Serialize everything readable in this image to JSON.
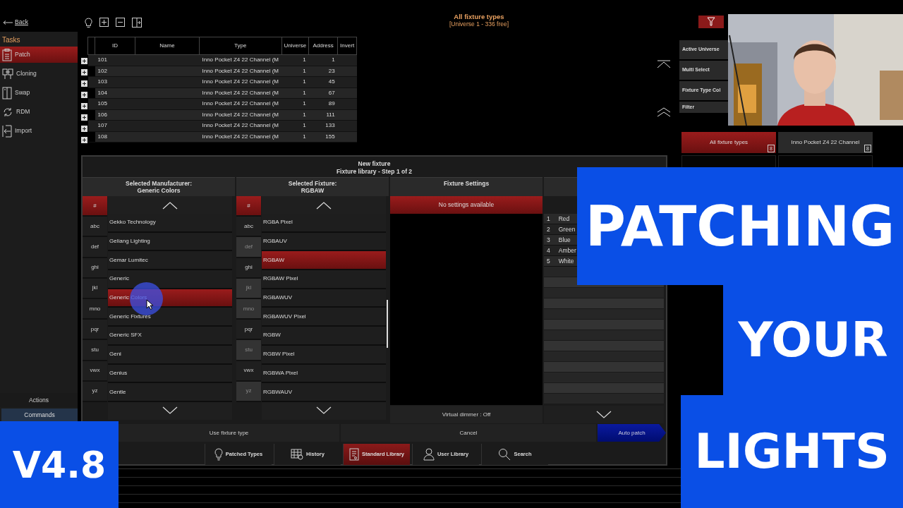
{
  "sidebar": {
    "back": "Back",
    "section": "Tasks",
    "items": [
      {
        "label": "Patch",
        "selected": true
      },
      {
        "label": "Cloning",
        "selected": false
      },
      {
        "label": "Swap",
        "selected": false
      },
      {
        "label": "RDM",
        "selected": false
      },
      {
        "label": "Import",
        "selected": false
      }
    ],
    "actions_label": "Actions",
    "commands": "Commands"
  },
  "header": {
    "title": "All fixture types",
    "subtitle": "[Universe 1 - 336 free]"
  },
  "table": {
    "columns": [
      "ID",
      "Name",
      "Type",
      "Universe",
      "Address",
      "Invert"
    ],
    "rows": [
      {
        "id": "101",
        "type": "Inno Pocket Z4 22 Channel (M",
        "universe": "1",
        "address": "1"
      },
      {
        "id": "102",
        "type": "Inno Pocket Z4 22 Channel (M",
        "universe": "1",
        "address": "23"
      },
      {
        "id": "103",
        "type": "Inno Pocket Z4 22 Channel (M",
        "universe": "1",
        "address": "45"
      },
      {
        "id": "104",
        "type": "Inno Pocket Z4 22 Channel (M",
        "universe": "1",
        "address": "67"
      },
      {
        "id": "105",
        "type": "Inno Pocket Z4 22 Channel (M",
        "universe": "1",
        "address": "89"
      },
      {
        "id": "106",
        "type": "Inno Pocket Z4 22 Channel (M",
        "universe": "1",
        "address": "111"
      },
      {
        "id": "107",
        "type": "Inno Pocket Z4 22 Channel (M",
        "universe": "1",
        "address": "133"
      },
      {
        "id": "108",
        "type": "Inno Pocket Z4 22 Channel (M",
        "universe": "1",
        "address": "155"
      }
    ]
  },
  "right_panel": {
    "buttons": [
      "Active Universe",
      "Multi Select",
      "Fixture Type Col",
      "Filter"
    ],
    "fixture_types": [
      {
        "label": "All fixture types",
        "count": "8",
        "selected": true
      },
      {
        "label": "Inno Pocket Z4 22 Channel",
        "count": "8",
        "selected": false
      }
    ]
  },
  "dialog": {
    "title": "New fixture",
    "subtitle": "Fixture library - Step 1 of 2",
    "manufacturer": {
      "heading": "Selected Manufacturer:",
      "value": "Generic Colors",
      "letters": [
        {
          "label": "#",
          "selected": true,
          "disabled": false
        },
        {
          "label": "abc",
          "selected": false,
          "disabled": false
        },
        {
          "label": "def",
          "selected": false,
          "disabled": false
        },
        {
          "label": "ghi",
          "selected": false,
          "disabled": false
        },
        {
          "label": "jkl",
          "selected": false,
          "disabled": false
        },
        {
          "label": "mno",
          "selected": false,
          "disabled": false
        },
        {
          "label": "pqr",
          "selected": false,
          "disabled": false
        },
        {
          "label": "stu",
          "selected": false,
          "disabled": false
        },
        {
          "label": "vwx",
          "selected": false,
          "disabled": false
        },
        {
          "label": "yz",
          "selected": false,
          "disabled": false
        }
      ],
      "items": [
        {
          "label": "Gekko Technology",
          "selected": false
        },
        {
          "label": "Geliang Lighting",
          "selected": false
        },
        {
          "label": "Gemar Lumitec",
          "selected": false
        },
        {
          "label": "Generic",
          "selected": false
        },
        {
          "label": "Generic Colors",
          "selected": true
        },
        {
          "label": "Generic Fixtures",
          "selected": false
        },
        {
          "label": "Generic SFX",
          "selected": false
        },
        {
          "label": "Geni",
          "selected": false
        },
        {
          "label": "Genius",
          "selected": false
        },
        {
          "label": "Gentle",
          "selected": false
        }
      ]
    },
    "fixture": {
      "heading": "Selected Fixture:",
      "value": "RGBAW",
      "letters": [
        {
          "label": "#",
          "selected": true,
          "disabled": false
        },
        {
          "label": "abc",
          "selected": false,
          "disabled": false
        },
        {
          "label": "def",
          "selected": false,
          "disabled": true
        },
        {
          "label": "ghi",
          "selected": false,
          "disabled": false
        },
        {
          "label": "jkl",
          "selected": false,
          "disabled": true
        },
        {
          "label": "mno",
          "selected": false,
          "disabled": true
        },
        {
          "label": "pqr",
          "selected": false,
          "disabled": false
        },
        {
          "label": "stu",
          "selected": false,
          "disabled": true
        },
        {
          "label": "vwx",
          "selected": false,
          "disabled": false
        },
        {
          "label": "yz",
          "selected": false,
          "disabled": true
        }
      ],
      "items": [
        {
          "label": "RGBA Pixel",
          "selected": false
        },
        {
          "label": "RGBAUV",
          "selected": false
        },
        {
          "label": "RGBAW",
          "selected": true
        },
        {
          "label": "RGBAW Pixel",
          "selected": false
        },
        {
          "label": "RGBAWUV",
          "selected": false
        },
        {
          "label": "RGBAWUV Pixel",
          "selected": false
        },
        {
          "label": "RGBW",
          "selected": false
        },
        {
          "label": "RGBW Pixel",
          "selected": false
        },
        {
          "label": "RGBWA Pixel",
          "selected": false
        },
        {
          "label": "RGBWAUV",
          "selected": false
        }
      ]
    },
    "settings": {
      "heading": "Fixture Settings",
      "notice": "No settings available",
      "virtual_dimmer": "Virtual dimmer : Off"
    },
    "channels": [
      {
        "number": "1",
        "name": "Red"
      },
      {
        "number": "2",
        "name": "Green"
      },
      {
        "number": "3",
        "name": "Blue"
      },
      {
        "number": "4",
        "name": "Amber"
      },
      {
        "number": "5",
        "name": "White"
      }
    ],
    "buttons": [
      {
        "label": "Use fixture type",
        "kind": "normal"
      },
      {
        "label": "Cancel",
        "kind": "normal"
      },
      {
        "label": "Auto patch",
        "kind": "primary"
      }
    ],
    "tabs": [
      {
        "label": "Patched Types",
        "selected": false
      },
      {
        "label": "History",
        "selected": false
      },
      {
        "label": "Standard Library",
        "selected": true
      },
      {
        "label": "User Library",
        "selected": false
      },
      {
        "label": "Search",
        "selected": false
      }
    ]
  },
  "overlay": {
    "title_lines": [
      "PATCHING",
      "YOUR",
      "LIGHTS"
    ],
    "version": "V4.8"
  }
}
